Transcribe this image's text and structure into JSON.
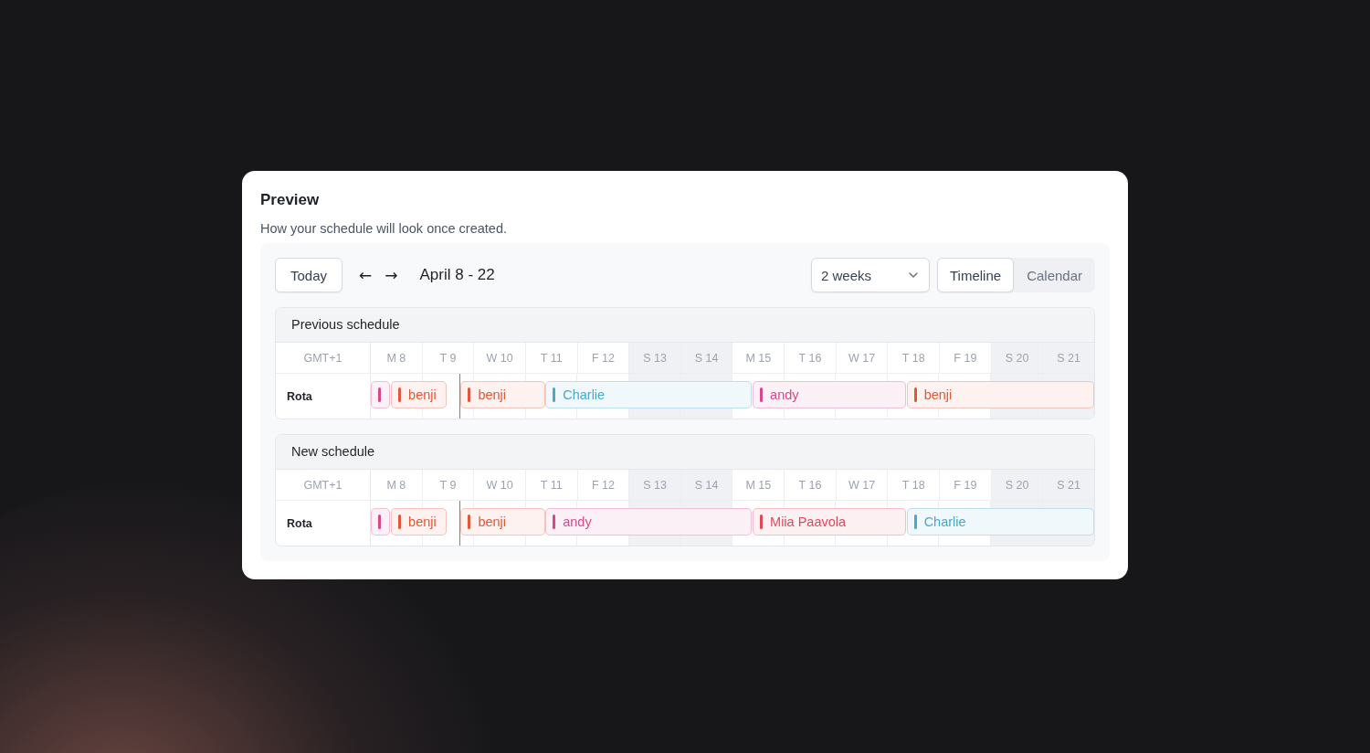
{
  "card": {
    "title": "Preview",
    "description": "How your schedule will look once created."
  },
  "toolbar": {
    "today_button": "Today",
    "prev_icon": "←",
    "next_icon": "→",
    "date_range": "April 8 - 22",
    "range_select": {
      "value": "2 weeks"
    },
    "view_tabs": [
      {
        "label": "Timeline",
        "selected": true
      },
      {
        "label": "Calendar",
        "selected": false
      }
    ]
  },
  "schedules": [
    {
      "title": "Previous schedule",
      "timezone": "GMT+1",
      "days": [
        {
          "label": "M 8",
          "weekend": false
        },
        {
          "label": "T 9",
          "weekend": false
        },
        {
          "label": "W 10",
          "weekend": false
        },
        {
          "label": "T 11",
          "weekend": false
        },
        {
          "label": "F 12",
          "weekend": false
        },
        {
          "label": "S 13",
          "weekend": true
        },
        {
          "label": "S 14",
          "weekend": true
        },
        {
          "label": "M 15",
          "weekend": false
        },
        {
          "label": "T 16",
          "weekend": false
        },
        {
          "label": "W 17",
          "weekend": false
        },
        {
          "label": "T 18",
          "weekend": false
        },
        {
          "label": "F 19",
          "weekend": false
        },
        {
          "label": "S 20",
          "weekend": true
        },
        {
          "label": "S 21",
          "weekend": true
        }
      ],
      "rows": [
        {
          "label": "Rota",
          "shifts": [
            {
              "color": "#d9478a"
            },
            {
              "name": "benji",
              "color": "#e2573a"
            },
            {
              "name": "benji",
              "color": "#e2573a"
            },
            {
              "name": "Charlie",
              "color": "#47a9cc"
            },
            {
              "name": "andy",
              "color": "#d9478a"
            },
            {
              "name": "benji",
              "color": "#e2573a"
            }
          ]
        }
      ]
    },
    {
      "title": "New schedule",
      "timezone": "GMT+1",
      "days": [
        {
          "label": "M 8",
          "weekend": false
        },
        {
          "label": "T 9",
          "weekend": false
        },
        {
          "label": "W 10",
          "weekend": false
        },
        {
          "label": "T 11",
          "weekend": false
        },
        {
          "label": "F 12",
          "weekend": false
        },
        {
          "label": "S 13",
          "weekend": true
        },
        {
          "label": "S 14",
          "weekend": true
        },
        {
          "label": "M 15",
          "weekend": false
        },
        {
          "label": "T 16",
          "weekend": false
        },
        {
          "label": "W 17",
          "weekend": false
        },
        {
          "label": "T 18",
          "weekend": false
        },
        {
          "label": "F 19",
          "weekend": false
        },
        {
          "label": "S 20",
          "weekend": true
        },
        {
          "label": "S 21",
          "weekend": true
        }
      ],
      "rows": [
        {
          "label": "Rota",
          "shifts": [
            {
              "color": "#d9478a"
            },
            {
              "name": "benji",
              "color": "#e2573a"
            },
            {
              "name": "benji",
              "color": "#e2573a"
            },
            {
              "name": "andy",
              "color": "#d9478a"
            },
            {
              "name": "Miia Paavola",
              "color": "#e0485a"
            },
            {
              "name": "Charlie",
              "color": "#47a9cc"
            }
          ]
        }
      ]
    }
  ]
}
